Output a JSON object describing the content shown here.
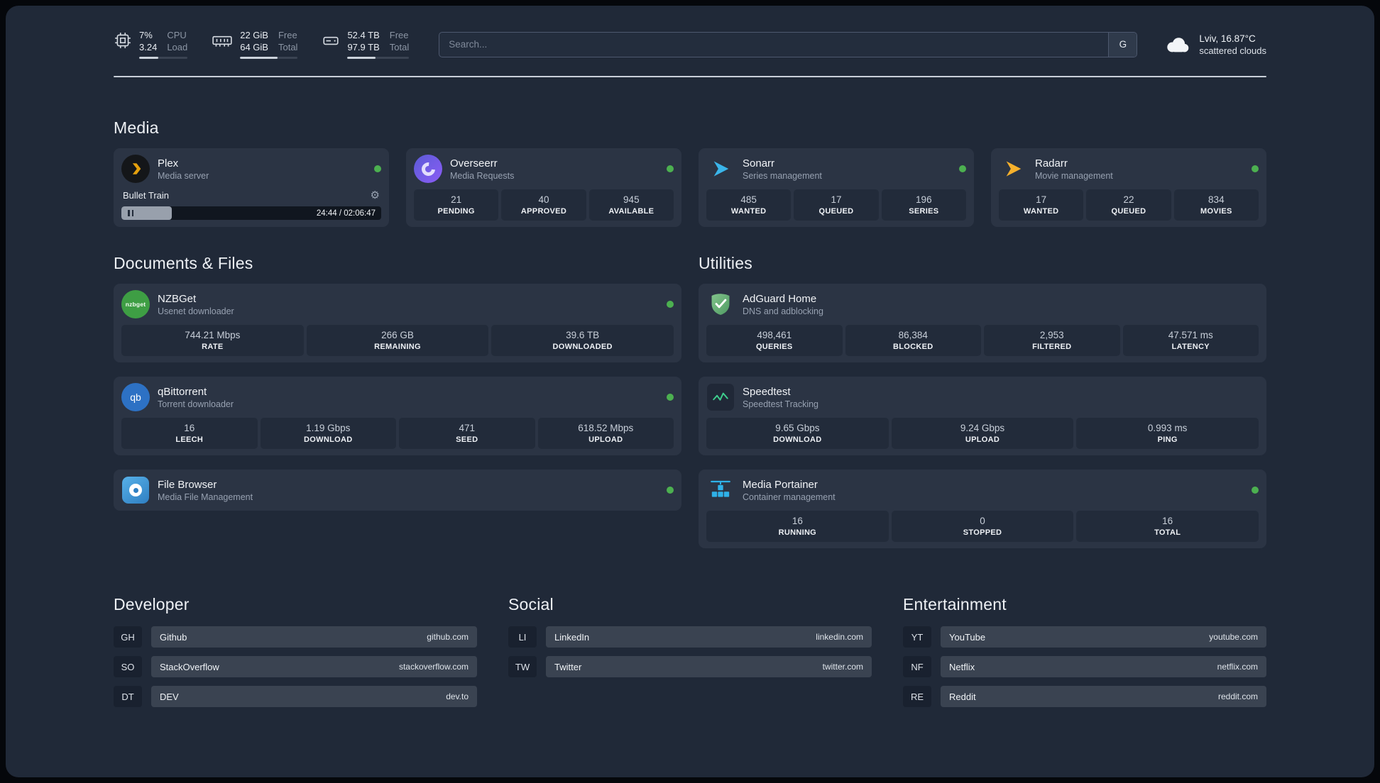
{
  "topbar": {
    "cpu": {
      "value1": "7%",
      "value2": "3.24",
      "label1": "CPU",
      "label2": "Load",
      "bar_percent": 40
    },
    "memory": {
      "value1": "22 GiB",
      "value2": "64 GiB",
      "label1": "Free",
      "label2": "Total",
      "bar_percent": 65
    },
    "disk": {
      "value1": "52.4 TB",
      "value2": "97.9 TB",
      "label1": "Free",
      "label2": "Total",
      "bar_percent": 46
    },
    "search": {
      "placeholder": "Search...",
      "provider_label": "G"
    },
    "weather": {
      "location": "Lviv, 16.87°C",
      "condition": "scattered clouds"
    }
  },
  "sections": {
    "media": "Media",
    "documents": "Documents & Files",
    "utilities": "Utilities",
    "developer": "Developer",
    "social": "Social",
    "entertainment": "Entertainment"
  },
  "icons": {
    "gear": "⚙",
    "nzbget_text": "nzbget",
    "qb_text": "qb"
  },
  "services": {
    "plex": {
      "name": "Plex",
      "desc": "Media server",
      "now_playing": "Bullet Train",
      "time": "24:44 / 02:06:47",
      "progress_percent": 19.5
    },
    "overseerr": {
      "name": "Overseerr",
      "desc": "Media Requests",
      "stats": [
        {
          "value": "21",
          "label": "PENDING"
        },
        {
          "value": "40",
          "label": "APPROVED"
        },
        {
          "value": "945",
          "label": "AVAILABLE"
        }
      ]
    },
    "sonarr": {
      "name": "Sonarr",
      "desc": "Series management",
      "stats": [
        {
          "value": "485",
          "label": "WANTED"
        },
        {
          "value": "17",
          "label": "QUEUED"
        },
        {
          "value": "196",
          "label": "SERIES"
        }
      ]
    },
    "radarr": {
      "name": "Radarr",
      "desc": "Movie management",
      "stats": [
        {
          "value": "17",
          "label": "WANTED"
        },
        {
          "value": "22",
          "label": "QUEUED"
        },
        {
          "value": "834",
          "label": "MOVIES"
        }
      ]
    },
    "nzbget": {
      "name": "NZBGet",
      "desc": "Usenet downloader",
      "stats": [
        {
          "value": "744.21 Mbps",
          "label": "RATE"
        },
        {
          "value": "266 GB",
          "label": "REMAINING"
        },
        {
          "value": "39.6 TB",
          "label": "DOWNLOADED"
        }
      ]
    },
    "qbittorrent": {
      "name": "qBittorrent",
      "desc": "Torrent downloader",
      "stats": [
        {
          "value": "16",
          "label": "LEECH"
        },
        {
          "value": "1.19 Gbps",
          "label": "DOWNLOAD"
        },
        {
          "value": "471",
          "label": "SEED"
        },
        {
          "value": "618.52 Mbps",
          "label": "UPLOAD"
        }
      ]
    },
    "filebrowser": {
      "name": "File Browser",
      "desc": "Media File Management"
    },
    "adguard": {
      "name": "AdGuard Home",
      "desc": "DNS and adblocking",
      "stats": [
        {
          "value": "498,461",
          "label": "QUERIES"
        },
        {
          "value": "86,384",
          "label": "BLOCKED"
        },
        {
          "value": "2,953",
          "label": "FILTERED"
        },
        {
          "value": "47.571 ms",
          "label": "LATENCY"
        }
      ]
    },
    "speedtest": {
      "name": "Speedtest",
      "desc": "Speedtest Tracking",
      "stats": [
        {
          "value": "9.65 Gbps",
          "label": "DOWNLOAD"
        },
        {
          "value": "9.24 Gbps",
          "label": "UPLOAD"
        },
        {
          "value": "0.993 ms",
          "label": "PING"
        }
      ]
    },
    "portainer": {
      "name": "Media Portainer",
      "desc": "Container management",
      "stats": [
        {
          "value": "16",
          "label": "RUNNING"
        },
        {
          "value": "0",
          "label": "STOPPED"
        },
        {
          "value": "16",
          "label": "TOTAL"
        }
      ]
    }
  },
  "bookmarks": {
    "developer": [
      {
        "abbr": "GH",
        "name": "Github",
        "url": "github.com"
      },
      {
        "abbr": "SO",
        "name": "StackOverflow",
        "url": "stackoverflow.com"
      },
      {
        "abbr": "DT",
        "name": "DEV",
        "url": "dev.to"
      }
    ],
    "social": [
      {
        "abbr": "LI",
        "name": "LinkedIn",
        "url": "linkedin.com"
      },
      {
        "abbr": "TW",
        "name": "Twitter",
        "url": "twitter.com"
      }
    ],
    "entertainment": [
      {
        "abbr": "YT",
        "name": "YouTube",
        "url": "youtube.com"
      },
      {
        "abbr": "NF",
        "name": "Netflix",
        "url": "netflix.com"
      },
      {
        "abbr": "RE",
        "name": "Reddit",
        "url": "reddit.com"
      }
    ]
  }
}
